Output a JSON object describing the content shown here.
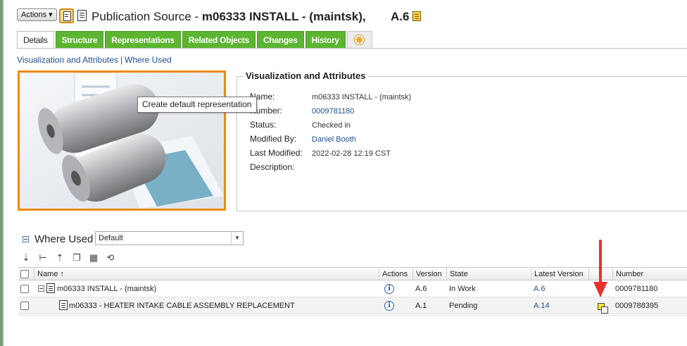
{
  "header": {
    "actions_label": "Actions ▾",
    "title_prefix": "Publication Source - ",
    "title_main": "m06333 INSTALL -  (maintsk),",
    "version": "A.6"
  },
  "tabs": [
    {
      "label": "Details",
      "active": true
    },
    {
      "label": "Structure"
    },
    {
      "label": "Representations"
    },
    {
      "label": "Related Objects"
    },
    {
      "label": "Changes"
    },
    {
      "label": "History"
    }
  ],
  "breadcrumbs": {
    "visualization": "Visualization and Attributes",
    "separator": "|",
    "where_used": "Where Used"
  },
  "tooltip": "Create default representation",
  "attributes": {
    "section_title": "Visualization and Attributes",
    "rows": [
      {
        "key": "Name:",
        "value": "m06333 INSTALL -  (maintsk)",
        "link": false
      },
      {
        "key": "Number:",
        "value": "0009781180",
        "link": true
      },
      {
        "key": "Status:",
        "value": "Checked in",
        "link": false
      },
      {
        "key": "Modified By:",
        "value": "Daniel Booth",
        "link": true
      },
      {
        "key": "Last Modified:",
        "value": "2022-02-28 12:19 CST",
        "link": false
      },
      {
        "key": "Description:",
        "value": "",
        "link": false
      }
    ]
  },
  "where_used": {
    "label": "Where Used",
    "view_selected": "Default",
    "columns": {
      "name": "Name ↑",
      "actions": "Actions",
      "version": "Version",
      "state": "State",
      "latest_version": "Latest Version",
      "number": "Number"
    },
    "rows": [
      {
        "name": "m06333 INSTALL -  (maintsk)",
        "version": "A.6",
        "state": "In Work",
        "latest_version": "A.6",
        "number": "0009781180"
      },
      {
        "name": "m06333 - HEATER INTAKE CABLE ASSEMBLY REPLACEMENT",
        "version": "A.1",
        "state": "Pending",
        "latest_version": "A.14",
        "number": "0009788395"
      }
    ]
  },
  "colors": {
    "tab_green": "#5cb531",
    "thumb_border": "#ee8a06",
    "link_blue": "#1f4e8c",
    "annotation_red": "#e8302f"
  }
}
